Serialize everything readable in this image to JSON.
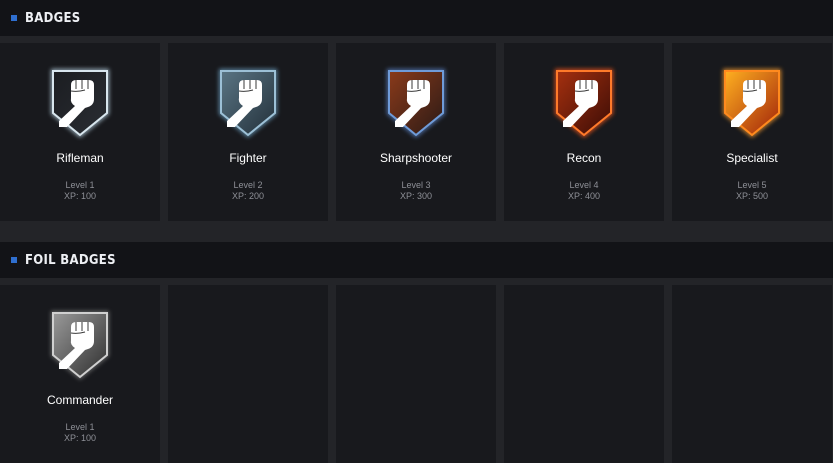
{
  "sections": [
    {
      "title": "BADGES",
      "badges": [
        {
          "name": "Rifleman",
          "level": "Level 1",
          "xp": "XP: 100",
          "icon": "fist-shield-icon",
          "style": "steel"
        },
        {
          "name": "Fighter",
          "level": "Level 2",
          "xp": "XP: 200",
          "icon": "fist-shield-icon",
          "style": "blue-steel"
        },
        {
          "name": "Sharpshooter",
          "level": "Level 3",
          "xp": "XP: 300",
          "icon": "fist-shield-icon",
          "style": "rust-blue"
        },
        {
          "name": "Recon",
          "level": "Level 4",
          "xp": "XP: 400",
          "icon": "fist-shield-icon",
          "style": "red-orange"
        },
        {
          "name": "Specialist",
          "level": "Level 5",
          "xp": "XP: 500",
          "icon": "fist-shield-icon",
          "style": "gold-orange"
        }
      ]
    },
    {
      "title": "FOIL BADGES",
      "badges": [
        {
          "name": "Commander",
          "level": "Level 1",
          "xp": "XP: 100",
          "icon": "fist-shield-icon",
          "style": "foil-silver"
        }
      ]
    }
  ],
  "colors": {
    "accent": "#2f6fd0",
    "header_bg": "#121317",
    "card_bg": "#18191d",
    "page_bg": "#232428"
  }
}
